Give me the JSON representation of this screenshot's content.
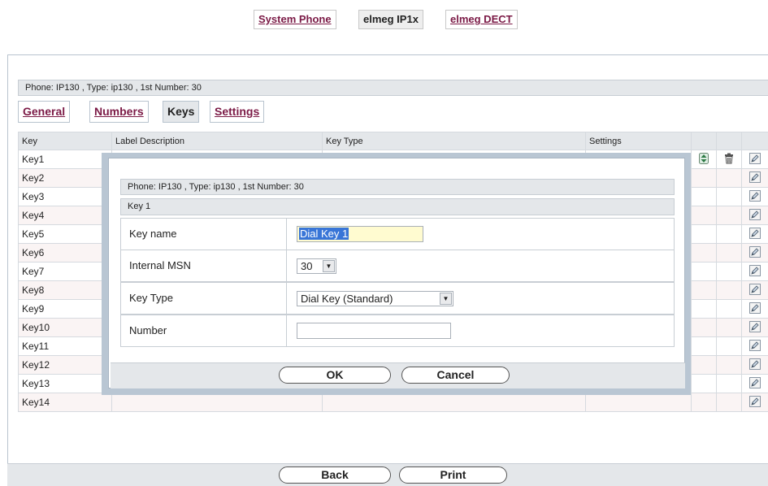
{
  "top_tabs": [
    {
      "label": "System Phone",
      "active": false
    },
    {
      "label": "elmeg IP1x",
      "active": true
    },
    {
      "label": "elmeg DECT",
      "active": false
    }
  ],
  "info_line": "Phone: IP130 , Type: ip130 , 1st Number: 30",
  "sub_tabs": [
    {
      "label": "General",
      "active": false
    },
    {
      "label": "Numbers",
      "active": false
    },
    {
      "label": "Keys",
      "active": true
    },
    {
      "label": "Settings",
      "active": false
    }
  ],
  "table": {
    "headers": [
      "Key",
      "Label Description",
      "Key Type",
      "Settings"
    ],
    "rows": [
      "Key1",
      "Key2",
      "Key3",
      "Key4",
      "Key5",
      "Key6",
      "Key7",
      "Key8",
      "Key9",
      "Key10",
      "Key11",
      "Key12",
      "Key13",
      "Key14"
    ]
  },
  "icons": {
    "edit": "pencil-icon",
    "delete": "trash-icon",
    "move": "move-updown-icon"
  },
  "dialog": {
    "info_line": "Phone: IP130 , Type: ip130 , 1st Number: 30",
    "section": "Key 1",
    "fields": {
      "key_name": {
        "label": "Key name",
        "value": "Dial Key 1"
      },
      "internal_msn": {
        "label": "Internal MSN",
        "value": "30"
      },
      "key_type": {
        "label": "Key Type",
        "value": "Dial Key (Standard)"
      },
      "number": {
        "label": "Number",
        "value": ""
      }
    },
    "ok_label": "OK",
    "cancel_label": "Cancel"
  },
  "footer": {
    "back_label": "Back",
    "print_label": "Print"
  },
  "colors": {
    "link": "#7b1a46",
    "header_bg": "#e4e7ea",
    "modal_border": "#b9c6d3",
    "selection": "#3875d7",
    "field_highlight": "#fffbd0"
  }
}
